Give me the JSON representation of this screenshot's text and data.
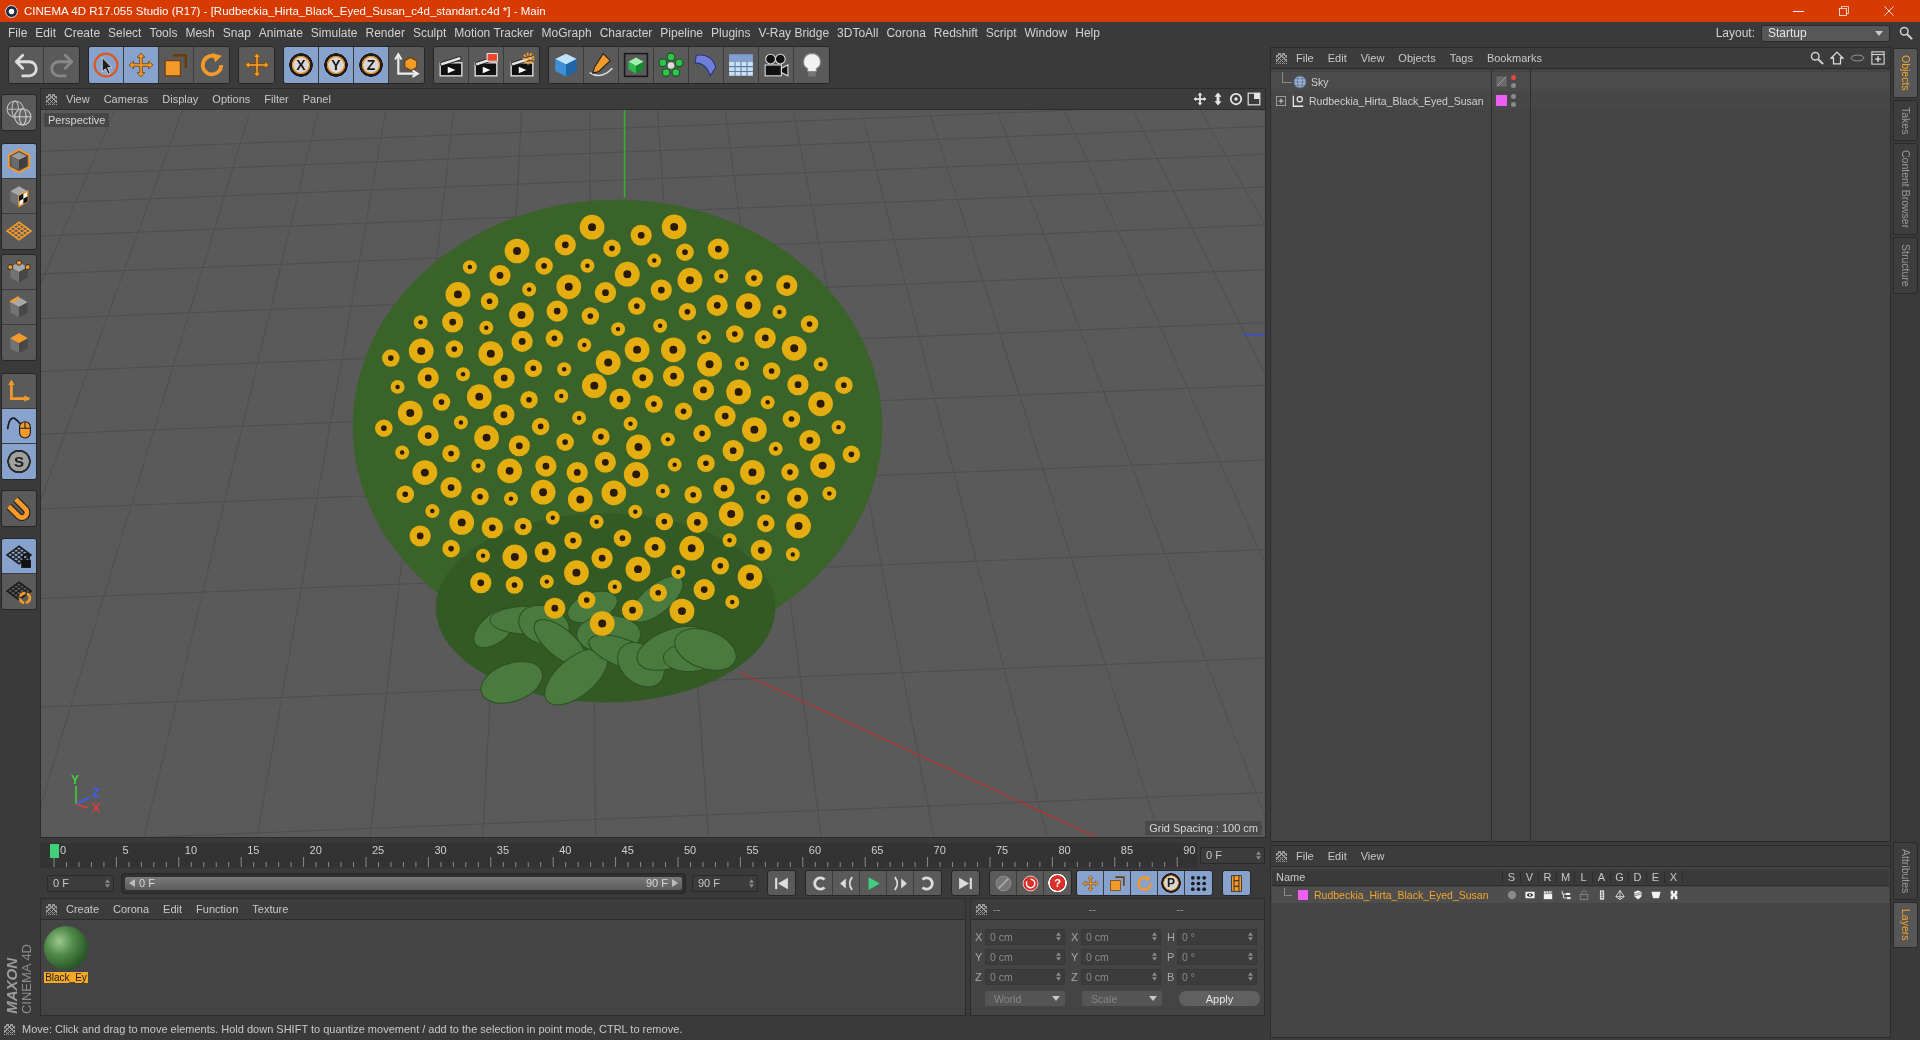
{
  "window": {
    "title": "CINEMA 4D R17.055 Studio (R17) - [Rudbeckia_Hirta_Black_Eyed_Susan_c4d_standart.c4d *] - Main"
  },
  "menu_bar": {
    "items": [
      "File",
      "Edit",
      "Create",
      "Select",
      "Tools",
      "Mesh",
      "Snap",
      "Animate",
      "Simulate",
      "Render",
      "Sculpt",
      "Motion Tracker",
      "MoGraph",
      "Character",
      "Pipeline",
      "Plugins",
      "V-Ray Bridge",
      "3DToAll",
      "Corona",
      "Redshift",
      "Script",
      "Window",
      "Help"
    ],
    "layout_label": "Layout:",
    "layout_value": "Startup"
  },
  "toolbar": {
    "groups": [
      [
        {
          "selected": false,
          "disabled": false
        },
        {
          "selected": false,
          "disabled": true
        }
      ],
      [
        {
          "selected": true
        },
        {
          "selected": true
        },
        {
          "selected": false
        },
        {
          "selected": false
        }
      ],
      [
        {
          "selected": false
        }
      ],
      [
        {
          "label": "X",
          "selected": true
        },
        {
          "label": "Y",
          "selected": true
        },
        {
          "label": "Z",
          "selected": true
        },
        {
          "selected": false
        }
      ],
      [
        {
          "selected": false
        },
        {
          "selected": false
        },
        {
          "selected": false
        }
      ],
      [
        {
          "selected": false
        },
        {
          "selected": false
        },
        {
          "selected": false
        },
        {
          "selected": false
        },
        {
          "selected": false
        },
        {
          "selected": false
        },
        {
          "selected": false
        },
        {
          "selected": false
        }
      ]
    ]
  },
  "left_toolbar": {
    "groups": [
      [
        {
          "selected": false
        }
      ],
      [
        {
          "selected": true
        },
        {
          "selected": false
        },
        {
          "selected": false
        }
      ],
      [
        {
          "selected": false
        },
        {
          "selected": false
        },
        {
          "selected": false
        }
      ],
      [
        {
          "selected": false
        },
        {
          "selected": true
        },
        {
          "label": "S",
          "selected": true
        }
      ],
      [
        {
          "selected": false
        }
      ],
      [
        {
          "selected": true
        },
        {
          "selected": false
        }
      ]
    ]
  },
  "viewport": {
    "menu": [
      "View",
      "Cameras",
      "Display",
      "Options",
      "Filter",
      "Panel"
    ],
    "camera": "Perspective",
    "grid_spacing": "Grid Spacing : 100 cm",
    "axes": [
      {
        "label": "Y",
        "color": "#3ad43a"
      },
      {
        "label": "Z",
        "color": "#3d5cff"
      },
      {
        "label": "X",
        "color": "#e03c3c"
      }
    ]
  },
  "timeline": {
    "ticks": [
      "0",
      "5",
      "10",
      "15",
      "20",
      "25",
      "30",
      "35",
      "40",
      "45",
      "50",
      "55",
      "60",
      "65",
      "70",
      "75",
      "80",
      "85",
      "90"
    ],
    "level": 0,
    "frame": "0 F"
  },
  "transport": {
    "start_field": "0 F",
    "range": {
      "start": "0 F",
      "end": "90 F",
      "level": 1
    },
    "end_field": "90 F",
    "groups": [
      [
        {
          "selected": false
        }
      ],
      [
        {
          "selected": false
        },
        {
          "selected": false
        },
        {
          "selected": false
        },
        {
          "selected": false
        },
        {
          "selected": false
        }
      ],
      [
        {
          "selected": false
        }
      ],
      [
        {
          "selected": false
        },
        {
          "selected": false
        },
        {
          "label": "?",
          "selected": false
        }
      ],
      [
        {
          "selected": true
        },
        {
          "selected": true
        },
        {
          "selected": true
        },
        {
          "label": "P",
          "selected": true
        },
        {
          "selected": true
        }
      ],
      [
        {
          "selected": true
        }
      ]
    ]
  },
  "material_manager": {
    "menu": [
      "Create",
      "Corona",
      "Edit",
      "Function",
      "Texture"
    ],
    "materials": [
      {
        "name": "Black_Ey",
        "selected": true
      }
    ]
  },
  "coordinates": {
    "headers": [
      "--",
      "--",
      "--"
    ],
    "rows": [
      [
        {
          "axis": "X",
          "value": "0 cm"
        },
        {
          "axis": "X",
          "value": "0 cm"
        },
        {
          "axis": "H",
          "value": "0 °"
        }
      ],
      [
        {
          "axis": "Y",
          "value": "0 cm"
        },
        {
          "axis": "Y",
          "value": "0 cm"
        },
        {
          "axis": "P",
          "value": "0 °"
        }
      ],
      [
        {
          "axis": "Z",
          "value": "0 cm"
        },
        {
          "axis": "Z",
          "value": "0 cm"
        },
        {
          "axis": "B",
          "value": "0 °"
        }
      ]
    ],
    "dropdowns": [
      "World",
      "Scale"
    ],
    "apply": "Apply"
  },
  "logo": {
    "brand": "MAXON",
    "product": "CINEMA 4D"
  },
  "status_bar": {
    "text": "Move: Click and drag to move elements. Hold down SHIFT to quantize movement / add to the selection in point mode, CTRL to remove."
  },
  "object_manager": {
    "menu": [
      "File",
      "Edit",
      "View",
      "Objects",
      "Tags",
      "Bookmarks"
    ],
    "objects": [
      {
        "name": "Sky",
        "kind": "sky",
        "editor_visible": false
      },
      {
        "name": "Rudbeckia_Hirta_Black_Eyed_Susan",
        "kind": "null",
        "expanded": false,
        "color": "#ee5ff5",
        "editor_visible": true
      }
    ]
  },
  "layer_manager": {
    "menu": [
      "File",
      "Edit",
      "View"
    ],
    "columns": [
      "Name",
      "S",
      "V",
      "R",
      "M",
      "L",
      "A",
      "G",
      "D",
      "E",
      "X"
    ],
    "layers": [
      {
        "name": "Rudbeckia_Hirta_Black_Eyed_Susan",
        "color": "#ee5ff5",
        "selected": true,
        "flags": [
          {
            "on": false
          },
          {
            "on": true
          },
          {
            "on": true
          },
          {
            "on": true
          },
          {
            "on": false
          },
          {
            "on": true
          },
          {
            "on": true
          },
          {
            "on": true
          },
          {
            "on": true
          },
          {
            "on": true
          }
        ]
      }
    ]
  },
  "side_tabs": {
    "top": [
      {
        "label": "Objects",
        "selected": true
      },
      {
        "label": "Takes",
        "selected": false
      },
      {
        "label": "Content Browser",
        "selected": false
      },
      {
        "label": "Structure",
        "selected": false
      }
    ],
    "bottom": [
      {
        "label": "Attributes",
        "selected": false
      },
      {
        "label": "Layers",
        "selected": true
      }
    ]
  }
}
